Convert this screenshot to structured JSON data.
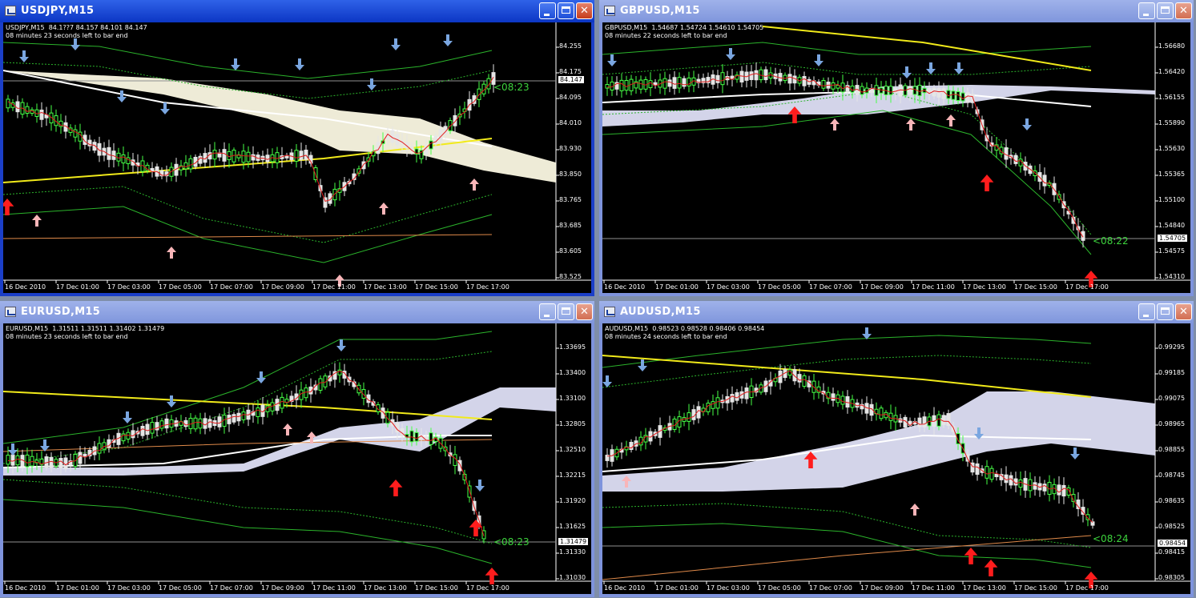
{
  "palette": {
    "up": "#46ff46",
    "down": "#e6e6e6",
    "cloud": "#fbf8e3",
    "cloud_bear": "#dedff5",
    "ma_yellow": "#f1ea1a",
    "ma_orange": "#e08a4a",
    "ma_red": "#e21b1b",
    "band_green": "#2bb32b",
    "arrow_blue": "#7aa6e0",
    "arrow_red": "#ff1d1d",
    "arrow_pink": "#f8b5b8",
    "price_line": "#8f8f8f",
    "axis": "#ffffff"
  },
  "windows": [
    {
      "id": "usdjpy",
      "title": "USDJPY,M15",
      "header_line1": "USDJPY,M15  84.1??7 84.157 84.101 84.147",
      "header_line2": "08 minutes 23 seconds left to bar end",
      "current_price": "84.147",
      "timer": "<08:23",
      "price_labels": [
        "84.255",
        "84.175",
        "84.095",
        "84.010",
        "83.930",
        "83.850",
        "83.765",
        "83.685",
        "83.605",
        "83.525"
      ],
      "time_labels": [
        "16 Dec 2010",
        "17 Dec 01:00",
        "17 Dec 03:00",
        "17 Dec 05:00",
        "17 Dec 07:00",
        "17 Dec 09:00",
        "17 Dec 11:00",
        "17 Dec 13:00",
        "17 Dec 15:00",
        "17 Dec 17:00"
      ],
      "seed": 11
    },
    {
      "id": "gbpusd",
      "title": "GBPUSD,M15",
      "header_line1": "GBPUSD,M15  1.54687 1.54724 1.54610 1.54705",
      "header_line2": "08 minutes 22 seconds left to bar end",
      "current_price": "1.54705",
      "timer": "<08:22",
      "price_labels": [
        "1.56680",
        "1.56420",
        "1.56155",
        "1.55890",
        "1.55630",
        "1.55365",
        "1.55100",
        "1.54840",
        "1.54575",
        "1.54310"
      ],
      "time_labels": [
        "16 Dec 2010",
        "17 Dec 01:00",
        "17 Dec 03:00",
        "17 Dec 05:00",
        "17 Dec 07:00",
        "17 Dec 09:00",
        "17 Dec 11:00",
        "17 Dec 13:00",
        "17 Dec 15:00",
        "17 Dec 17:00"
      ],
      "seed": 23
    },
    {
      "id": "eurusd",
      "title": "EURUSD,M15",
      "header_line1": "EURUSD,M15  1.31511 1.31511 1.31402 1.31479",
      "header_line2": "08 minutes 23 seconds left to bar end",
      "current_price": "1.31479",
      "timer": "<08:23",
      "price_labels": [
        "1.33695",
        "1.33400",
        "1.33100",
        "1.32805",
        "1.32510",
        "1.32215",
        "1.31920",
        "1.31625",
        "1.31330",
        "1.31030"
      ],
      "time_labels": [
        "16 Dec 2010",
        "17 Dec 01:00",
        "17 Dec 03:00",
        "17 Dec 05:00",
        "17 Dec 07:00",
        "17 Dec 09:00",
        "17 Dec 11:00",
        "17 Dec 13:00",
        "17 Dec 15:00",
        "17 Dec 17:00"
      ],
      "seed": 37
    },
    {
      "id": "audusd",
      "title": "AUDUSD,M15",
      "header_line1": "AUDUSD,M15  0.98523 0.98528 0.98406 0.98454",
      "header_line2": "08 minutes 24 seconds left to bar end",
      "current_price": "0.98454",
      "timer": "<08:24",
      "price_labels": [
        "0.99295",
        "0.99185",
        "0.99075",
        "0.98965",
        "0.98855",
        "0.98745",
        "0.98635",
        "0.98525",
        "0.98415",
        "0.98305"
      ],
      "time_labels": [
        "16 Dec 2010",
        "17 Dec 01:00",
        "17 Dec 03:00",
        "17 Dec 05:00",
        "17 Dec 07:00",
        "17 Dec 09:00",
        "17 Dec 11:00",
        "17 Dec 13:00",
        "17 Dec 15:00",
        "17 Dec 17:00"
      ],
      "seed": 53
    }
  ]
}
